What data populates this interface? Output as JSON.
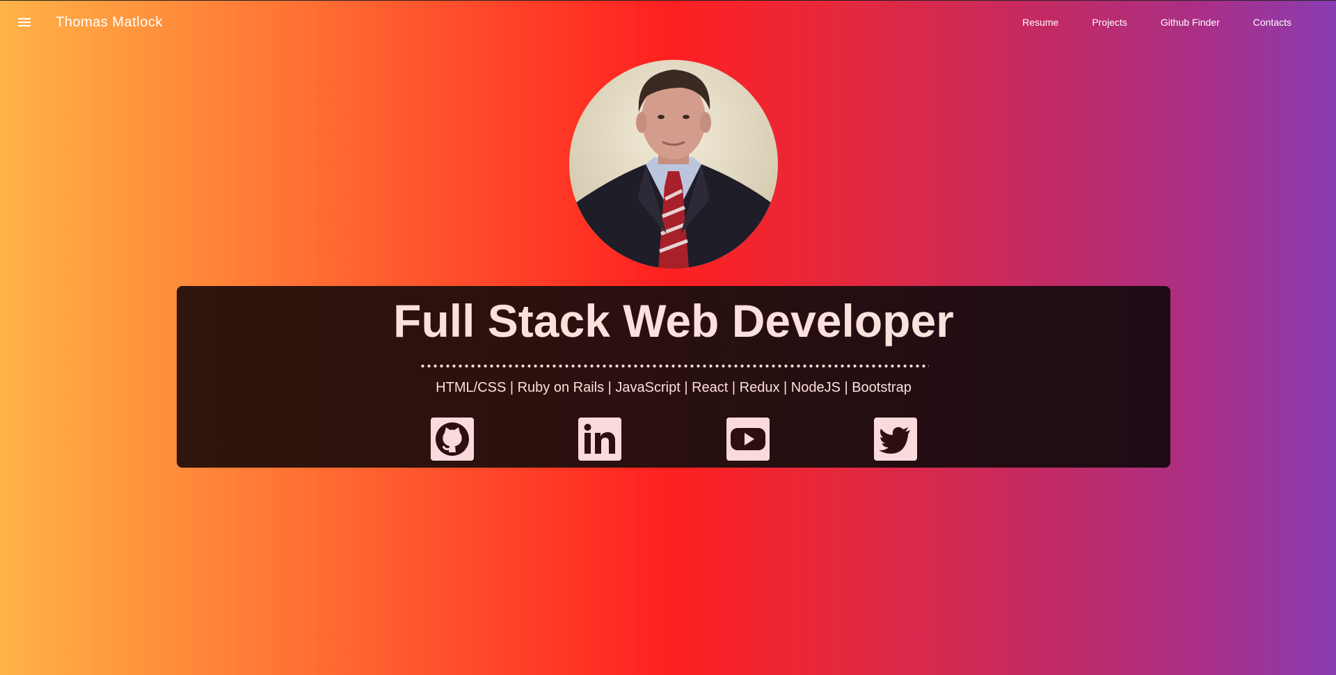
{
  "header": {
    "brand": "Thomas Matlock",
    "nav": [
      "Resume",
      "Projects",
      "Github Finder",
      "Contacts"
    ]
  },
  "hero": {
    "headline": "Full Stack Web Developer",
    "skills": "HTML/CSS | Ruby on Rails | JavaScript | React | Redux | NodeJS | Bootstrap"
  },
  "social": {
    "icons": [
      "github-icon",
      "linkedin-icon",
      "youtube-icon",
      "twitter-icon"
    ]
  },
  "colors": {
    "gradient_left": "#ffb347",
    "gradient_mid": "#ff2020",
    "gradient_right": "#8a3cb2",
    "card": "#2a100e",
    "text_light": "#fbe1de"
  }
}
